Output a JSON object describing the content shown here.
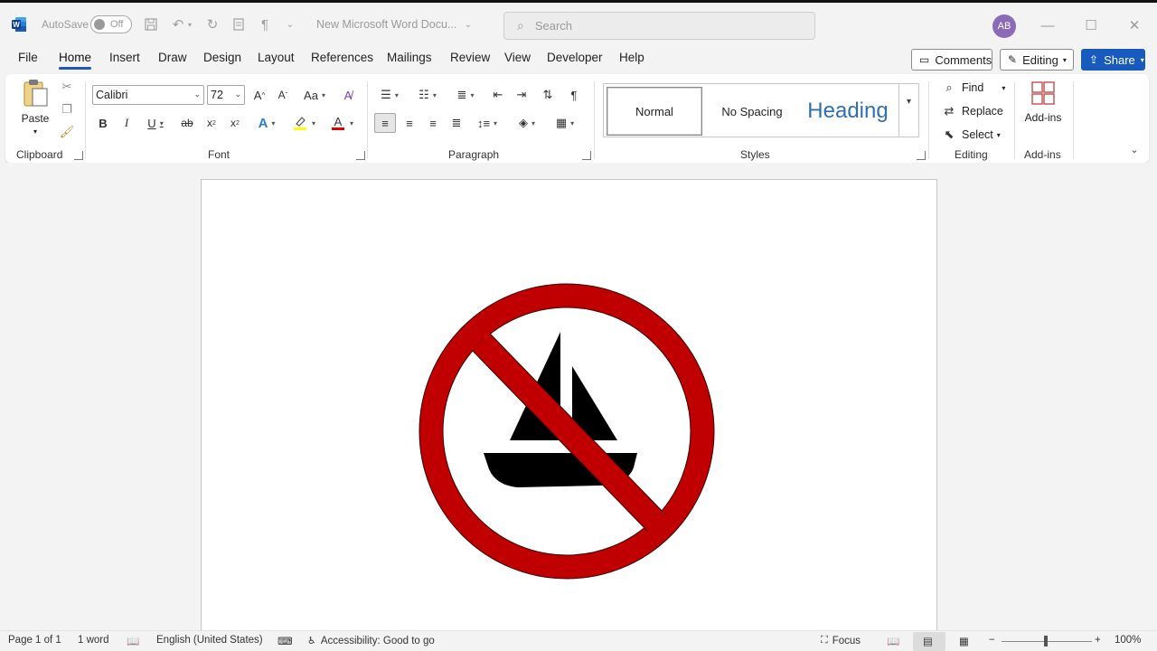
{
  "app": {
    "logo_icon": "word-logo-icon",
    "autosave_label": "AutoSave",
    "autosave_state": "Off",
    "doc_title": "New Microsoft Word Docu...",
    "search_placeholder": "Search",
    "user_initials": "AB"
  },
  "tabs": [
    "File",
    "Home",
    "Insert",
    "Draw",
    "Design",
    "Layout",
    "References",
    "Mailings",
    "Review",
    "View",
    "Developer",
    "Help"
  ],
  "active_tab": "Home",
  "right_buttons": {
    "comments": "Comments",
    "editing": "Editing",
    "share": "Share"
  },
  "ribbon": {
    "clipboard": {
      "paste": "Paste",
      "label": "Clipboard"
    },
    "font": {
      "family": "Calibri",
      "size": "72",
      "label": "Font",
      "change_case": "Aa"
    },
    "paragraph": {
      "label": "Paragraph"
    },
    "styles": {
      "normal": "Normal",
      "no_spacing": "No Spacing",
      "heading": "Heading",
      "label": "Styles"
    },
    "editing": {
      "find": "Find",
      "replace": "Replace",
      "select": "Select",
      "label": "Editing"
    },
    "addins": {
      "button": "Add-ins",
      "label": "Add-ins"
    }
  },
  "colors": {
    "accent": "#185abd",
    "sign_red": "#c00000",
    "highlight": "#ffff00",
    "font_color": "#e00000",
    "heading_blue": "#2e6fb5"
  },
  "status": {
    "page": "Page 1 of 1",
    "words": "1 word",
    "language": "English (United States)",
    "accessibility": "Accessibility: Good to go",
    "focus": "Focus",
    "zoom": "100%"
  }
}
